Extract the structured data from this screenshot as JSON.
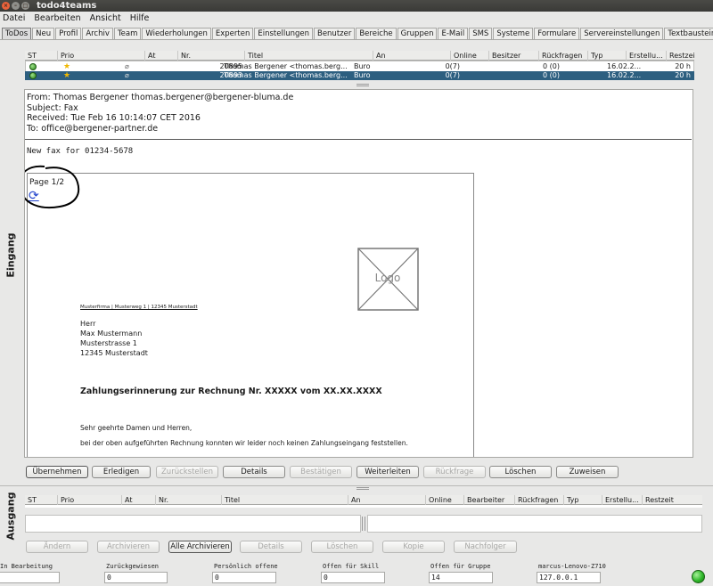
{
  "window": {
    "title": "todo4teams",
    "close": "×",
    "minimize": "–",
    "maximize": "□"
  },
  "menu": [
    "Datei",
    "Bearbeiten",
    "Ansicht",
    "Hilfe"
  ],
  "tabs": [
    "ToDos",
    "Neu",
    "Profil",
    "Archiv",
    "Team",
    "Wiederholungen",
    "Experten",
    "Einstellungen",
    "Benutzer",
    "Bereiche",
    "Gruppen",
    "E-Mail",
    "SMS",
    "Systeme",
    "Formulare",
    "Servereinstellungen",
    "Textbausteine"
  ],
  "incoming": {
    "label": "Eingang",
    "columns": [
      "ST",
      "Prio",
      "At",
      "Nr.",
      "Titel",
      "An",
      "Online",
      "Besitzer",
      "Rückfragen",
      "Typ",
      "Erstellu...",
      "Restzeit"
    ],
    "rows": [
      {
        "nr": "20895",
        "titel": "Thomas Bergener <thomas.berg...",
        "an": "Buro",
        "online": "0(7)",
        "rueck": "0 (0)",
        "erst": "16.02.2...",
        "rest": "20 h",
        "selected": false
      },
      {
        "nr": "20893",
        "titel": "Thomas Bergener <thomas.berg...",
        "an": "Buro",
        "online": "0(7)",
        "rueck": "0 (0)",
        "erst": "16.02.2...",
        "rest": "20 h",
        "selected": true
      }
    ]
  },
  "mail": {
    "from": "From: Thomas Bergener  thomas.bergener@bergener-bluma.de",
    "subject": "Subject: Fax",
    "received": "Received: Tue Feb 16 10:14:07 CET 2016",
    "to": "To: office@bergener-partner.de",
    "body": "New fax for 01234-5678",
    "page": "Page 1/2",
    "reload_icon": "⟳",
    "doc": {
      "logo": "Logo",
      "sender": "Musterfirma | Musterweg 1 | 12345 Musterstadt",
      "address": [
        "Herr",
        "Max Mustermann",
        "Musterstrasse 1",
        "12345 Musterstadt"
      ],
      "heading": "Zahlungserinnerung zur Rechnung Nr. XXXXX vom XX.XX.XXXX",
      "greeting": "Sehr geehrte Damen und Herren,",
      "text": "bei der oben aufgeführten Rechnung konnten wir leider noch keinen Zahlungseingang feststellen."
    }
  },
  "in_buttons": [
    "Übernehmen",
    "Erledigen",
    "Zurückstellen",
    "Details",
    "Bestätigen",
    "Weiterleiten",
    "Rückfrage",
    "Löschen",
    "Zuweisen"
  ],
  "outgoing": {
    "label": "Ausgang",
    "columns": [
      "ST",
      "Prio",
      "At",
      "Nr.",
      "Titel",
      "An",
      "Online",
      "Bearbeiter",
      "Rückfragen",
      "Typ",
      "Erstellu...",
      "Restzeit"
    ]
  },
  "out_buttons": [
    "Ändern",
    "Archivieren",
    "Alle Archivieren",
    "Details",
    "Löschen",
    "Kopie",
    "Nachfolger"
  ],
  "status": [
    {
      "label": "In Bearbeitung",
      "value": ""
    },
    {
      "label": "Zurückgewiesen",
      "value": "0"
    },
    {
      "label": "Persönlich offene",
      "value": "0"
    },
    {
      "label": "Offen für Skill",
      "value": "0"
    },
    {
      "label": "Offen für Gruppe",
      "value": "14"
    },
    {
      "label": "marcus-Lenovo-Z710",
      "value": "127.0.0.1"
    }
  ],
  "colors": {
    "selected_row": "#2d5f80",
    "status_light": "#2fb82a",
    "annotation": "#000000",
    "link_icon": "#2244cc"
  }
}
